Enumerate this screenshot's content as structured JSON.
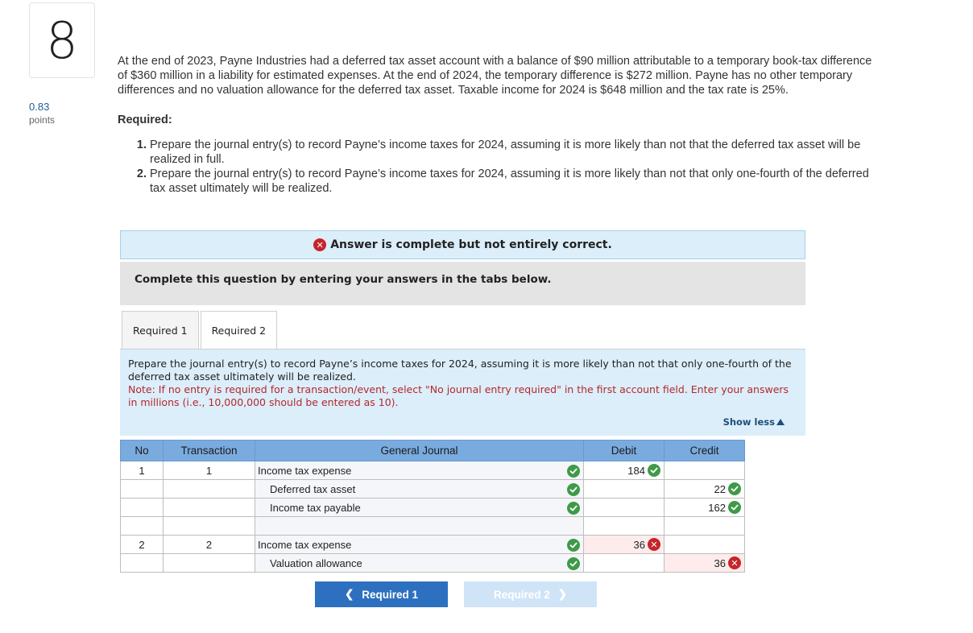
{
  "question": {
    "number": "8",
    "points_value": "0.83",
    "points_label": "points",
    "problem_text": "At the end of 2023, Payne Industries had a deferred tax asset account with a balance of $90 million attributable to a temporary book-tax difference of $360 million in a liability for estimated expenses. At the end of 2024, the temporary difference is $272 million. Payne has no other temporary differences and no valuation allowance for the deferred tax asset. Taxable income for 2024 is $648 million and the tax rate is 25%.",
    "required_heading": "Required:",
    "requirements": [
      "Prepare the journal entry(s) to record Payne’s income taxes for 2024, assuming it is more likely than not that the deferred tax asset will be realized in full.",
      "Prepare the journal entry(s) to record Payne’s income taxes for 2024, assuming it is more likely than not that only one-fourth of the deferred tax asset ultimately will be realized."
    ]
  },
  "banner": {
    "text": "Answer is complete but not entirely correct."
  },
  "instruction": "Complete this question by entering your answers in the tabs below.",
  "tabs": [
    {
      "label": "Required 1",
      "active": false
    },
    {
      "label": "Required 2",
      "active": true
    }
  ],
  "panel": {
    "prompt": "Prepare the journal entry(s) to record Payne’s income taxes for 2024, assuming it is more likely than not that only one-fourth of the deferred tax asset ultimately will be realized.",
    "note": "Note: If no entry is required for a transaction/event, select \"No journal entry required\" in the first account field. Enter your answers in millions (i.e., 10,000,000 should be entered as 10).",
    "show_less": "Show less"
  },
  "journal": {
    "headers": [
      "No",
      "Transaction",
      "General Journal",
      "Debit",
      "Credit"
    ],
    "rows": [
      {
        "no": "1",
        "transaction": "1",
        "account": "Income tax expense",
        "account_status": "correct",
        "debit": "184",
        "debit_status": "correct",
        "credit": "",
        "credit_status": ""
      },
      {
        "no": "",
        "transaction": "",
        "account": "Deferred tax asset",
        "account_status": "correct",
        "debit": "",
        "debit_status": "",
        "credit": "22",
        "credit_status": "correct"
      },
      {
        "no": "",
        "transaction": "",
        "account": "Income tax payable",
        "account_status": "correct",
        "debit": "",
        "debit_status": "",
        "credit": "162",
        "credit_status": "correct"
      },
      {
        "no": "",
        "transaction": "",
        "account": "",
        "account_status": "",
        "debit": "",
        "debit_status": "",
        "credit": "",
        "credit_status": ""
      },
      {
        "no": "2",
        "transaction": "2",
        "account": "Income tax expense",
        "account_status": "correct",
        "debit": "36",
        "debit_status": "incorrect",
        "credit": "",
        "credit_status": ""
      },
      {
        "no": "",
        "transaction": "",
        "account": "Valuation allowance",
        "account_status": "correct",
        "debit": "",
        "debit_status": "",
        "credit": "36",
        "credit_status": "incorrect"
      }
    ]
  },
  "nav": {
    "prev_label": "Required 1",
    "next_label": "Required 2"
  },
  "colors": {
    "correct": "#3f9a48",
    "incorrect": "#c5252b",
    "header": "#7aabdf",
    "panel": "#dceefa"
  }
}
